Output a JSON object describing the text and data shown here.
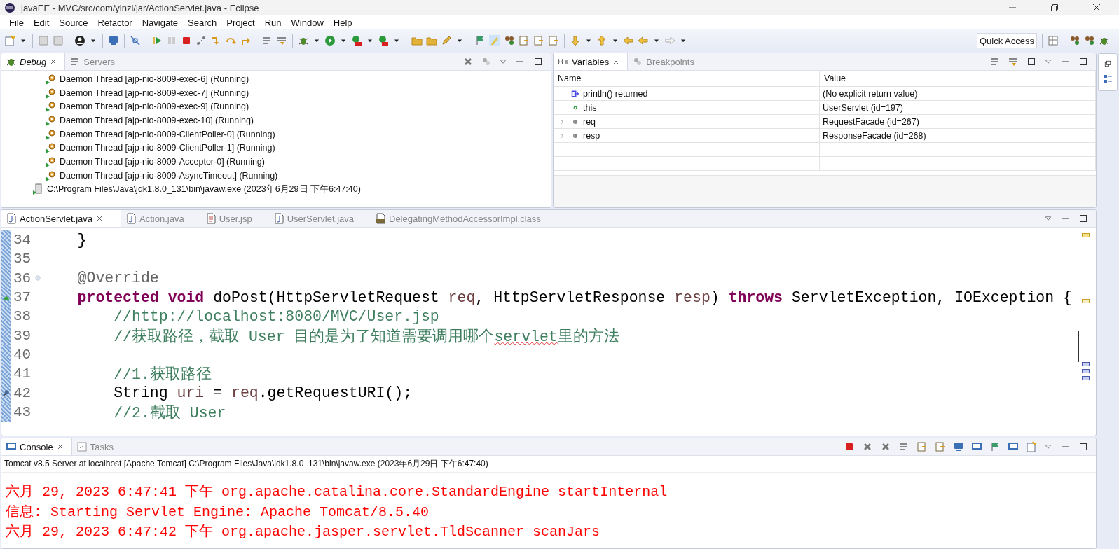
{
  "window": {
    "title": "javaEE - MVC/src/com/yinzi/jar/ActionServlet.java - Eclipse"
  },
  "menu": [
    "File",
    "Edit",
    "Source",
    "Refactor",
    "Navigate",
    "Search",
    "Project",
    "Run",
    "Window",
    "Help"
  ],
  "quick_access": {
    "placeholder": "Quick Access"
  },
  "debug_view": {
    "tabs": [
      {
        "label": "Debug",
        "selected": true
      },
      {
        "label": "Servers",
        "selected": false
      }
    ],
    "rows": [
      {
        "kind": "thread",
        "label": "Daemon Thread [ajp-nio-8009-exec-6] (Running)"
      },
      {
        "kind": "thread",
        "label": "Daemon Thread [ajp-nio-8009-exec-7] (Running)"
      },
      {
        "kind": "thread",
        "label": "Daemon Thread [ajp-nio-8009-exec-9] (Running)"
      },
      {
        "kind": "thread",
        "label": "Daemon Thread [ajp-nio-8009-exec-10] (Running)"
      },
      {
        "kind": "thread",
        "label": "Daemon Thread [ajp-nio-8009-ClientPoller-0] (Running)"
      },
      {
        "kind": "thread",
        "label": "Daemon Thread [ajp-nio-8009-ClientPoller-1] (Running)"
      },
      {
        "kind": "thread",
        "label": "Daemon Thread [ajp-nio-8009-Acceptor-0] (Running)"
      },
      {
        "kind": "thread",
        "label": "Daemon Thread [ajp-nio-8009-AsyncTimeout] (Running)"
      },
      {
        "kind": "process",
        "label": "C:\\Program Files\\Java\\jdk1.8.0_131\\bin\\javaw.exe (2023年6月29日 下午6:47:40)"
      }
    ]
  },
  "variables_view": {
    "tabs": [
      {
        "label": "Variables",
        "selected": true
      },
      {
        "label": "Breakpoints",
        "selected": false
      }
    ],
    "columns": [
      "Name",
      "Value"
    ],
    "rows": [
      {
        "kind": "return",
        "name": "println() returned",
        "value": "(No explicit return value)",
        "expandable": false
      },
      {
        "kind": "field",
        "name": "this",
        "value": "UserServlet  (id=197)",
        "expandable": false
      },
      {
        "kind": "local",
        "name": "req",
        "value": "RequestFacade  (id=267)",
        "expandable": true
      },
      {
        "kind": "local",
        "name": "resp",
        "value": "ResponseFacade  (id=268)",
        "expandable": true
      }
    ]
  },
  "editor": {
    "tabs": [
      {
        "label": "ActionServlet.java",
        "kind": "java",
        "selected": true
      },
      {
        "label": "Action.java",
        "kind": "java",
        "selected": false
      },
      {
        "label": "User.jsp",
        "kind": "jsp",
        "selected": false
      },
      {
        "label": "UserServlet.java",
        "kind": "java",
        "selected": false
      },
      {
        "label": "DelegatingMethodAccessorImpl.class",
        "kind": "class",
        "selected": false
      }
    ],
    "lines": [
      {
        "number": "34",
        "kind": "plain",
        "tokens": [
          {
            "kind": "plain",
            "text": "    }"
          }
        ]
      },
      {
        "number": "35",
        "kind": "plain"
      },
      {
        "number": "36",
        "kind": "fold",
        "tokens": [
          {
            "kind": "annotation",
            "text": "    @Override"
          }
        ]
      },
      {
        "number": "37",
        "kind": "override",
        "tokens": [
          {
            "kind": "keyword",
            "text": "    protected void"
          },
          {
            "kind": "plain",
            "text": " doPost(HttpServletRequest "
          },
          {
            "kind": "param",
            "text": "req"
          },
          {
            "kind": "plain",
            "text": ", HttpServletResponse "
          },
          {
            "kind": "param",
            "text": "resp"
          },
          {
            "kind": "plain",
            "text": ") "
          },
          {
            "kind": "keyword",
            "text": "throws"
          },
          {
            "kind": "plain",
            "text": " ServletException, IOException {"
          }
        ]
      },
      {
        "number": "38",
        "kind": "plain",
        "tokens": [
          {
            "kind": "comment",
            "text": "        //http://localhost:8080/MVC/User.jsp"
          }
        ]
      },
      {
        "number": "39",
        "kind": "plain",
        "tokens": [
          {
            "kind": "comment",
            "text": "        //获取路径，截取 User 目的是为了知道需要调用哪个"
          },
          {
            "kind": "comment",
            "text": "servlet",
            "flagged": true
          },
          {
            "kind": "comment",
            "text": "里的方法"
          }
        ]
      },
      {
        "number": "40",
        "kind": "plain"
      },
      {
        "number": "41",
        "kind": "plain",
        "tokens": [
          {
            "kind": "comment",
            "text": "        //1.获取路径"
          }
        ]
      },
      {
        "number": "42",
        "kind": "debug",
        "tokens": [
          {
            "kind": "plain",
            "text": "        String "
          },
          {
            "kind": "param",
            "text": "uri"
          },
          {
            "kind": "plain",
            "text": " = "
          },
          {
            "kind": "param",
            "text": "req"
          },
          {
            "kind": "plain",
            "text": ".getRequestURI();"
          }
        ]
      },
      {
        "number": "43",
        "kind": "plain",
        "tokens": [
          {
            "kind": "comment",
            "text": "        //2.截取 User"
          }
        ]
      }
    ]
  },
  "console_view": {
    "tabs": [
      {
        "label": "Console",
        "selected": true
      },
      {
        "label": "Tasks",
        "selected": false
      }
    ],
    "description": "Tomcat v8.5 Server at localhost [Apache Tomcat] C:\\Program Files\\Java\\jdk1.8.0_131\\bin\\javaw.exe (2023年6月29日 下午6:47:40)",
    "lines": [
      {
        "text": "六月 29, 2023 6:47:41 下午 org.apache.catalina.core.StandardEngine startInternal",
        "color": "#ff0000"
      },
      {
        "text": "信息: Starting Servlet Engine: Apache Tomcat/8.5.40",
        "color": "#ff0000"
      },
      {
        "text": "六月 29, 2023 6:47:42 下午 org.apache.jasper.servlet.TldScanner scanJars",
        "color": "#ff0000"
      }
    ]
  }
}
